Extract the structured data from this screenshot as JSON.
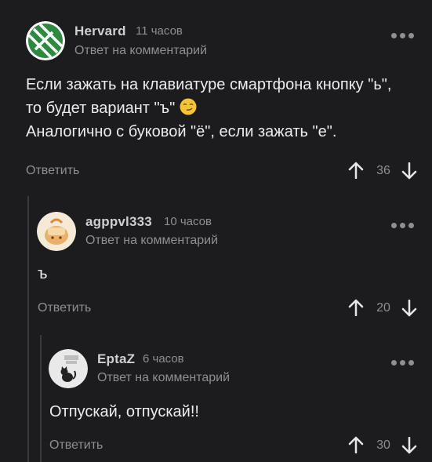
{
  "comments": [
    {
      "username": "Hervard",
      "time": "11 часов",
      "reply_note": "Ответ на комментарий",
      "lines": [
        "Если зажать на клавиатуре смартфона кнопку \"ь\",",
        "то будет вариант \"ъ\"",
        "Аналогично с буковой \"ё\", если зажать \"е\"."
      ],
      "emoji": "smirking-face",
      "reply_label": "Ответить",
      "score": "36",
      "avatar_colors": {
        "bg": "#2b8a3e",
        "stripes": "#ffffff"
      }
    },
    {
      "username": "agppvl333",
      "time": "10 часов",
      "reply_note": "Ответ на комментарий",
      "lines": [
        "ъ"
      ],
      "reply_label": "Ответить",
      "score": "20",
      "avatar_colors": {
        "bg": "#f5ead6",
        "accent": "#e0a45a"
      }
    },
    {
      "username": "EptaZ",
      "time": "6 часов",
      "reply_note": "Ответ на комментарий",
      "lines": [
        "Отпускай, отпускай!!"
      ],
      "reply_label": "Ответить",
      "score": "30",
      "avatar_colors": {
        "bg": "#e9e9e9",
        "accent": "#222222"
      }
    }
  ],
  "theme": {
    "background": "#1c1c1e",
    "muted": "#8e8e93",
    "text": "#ececec"
  }
}
